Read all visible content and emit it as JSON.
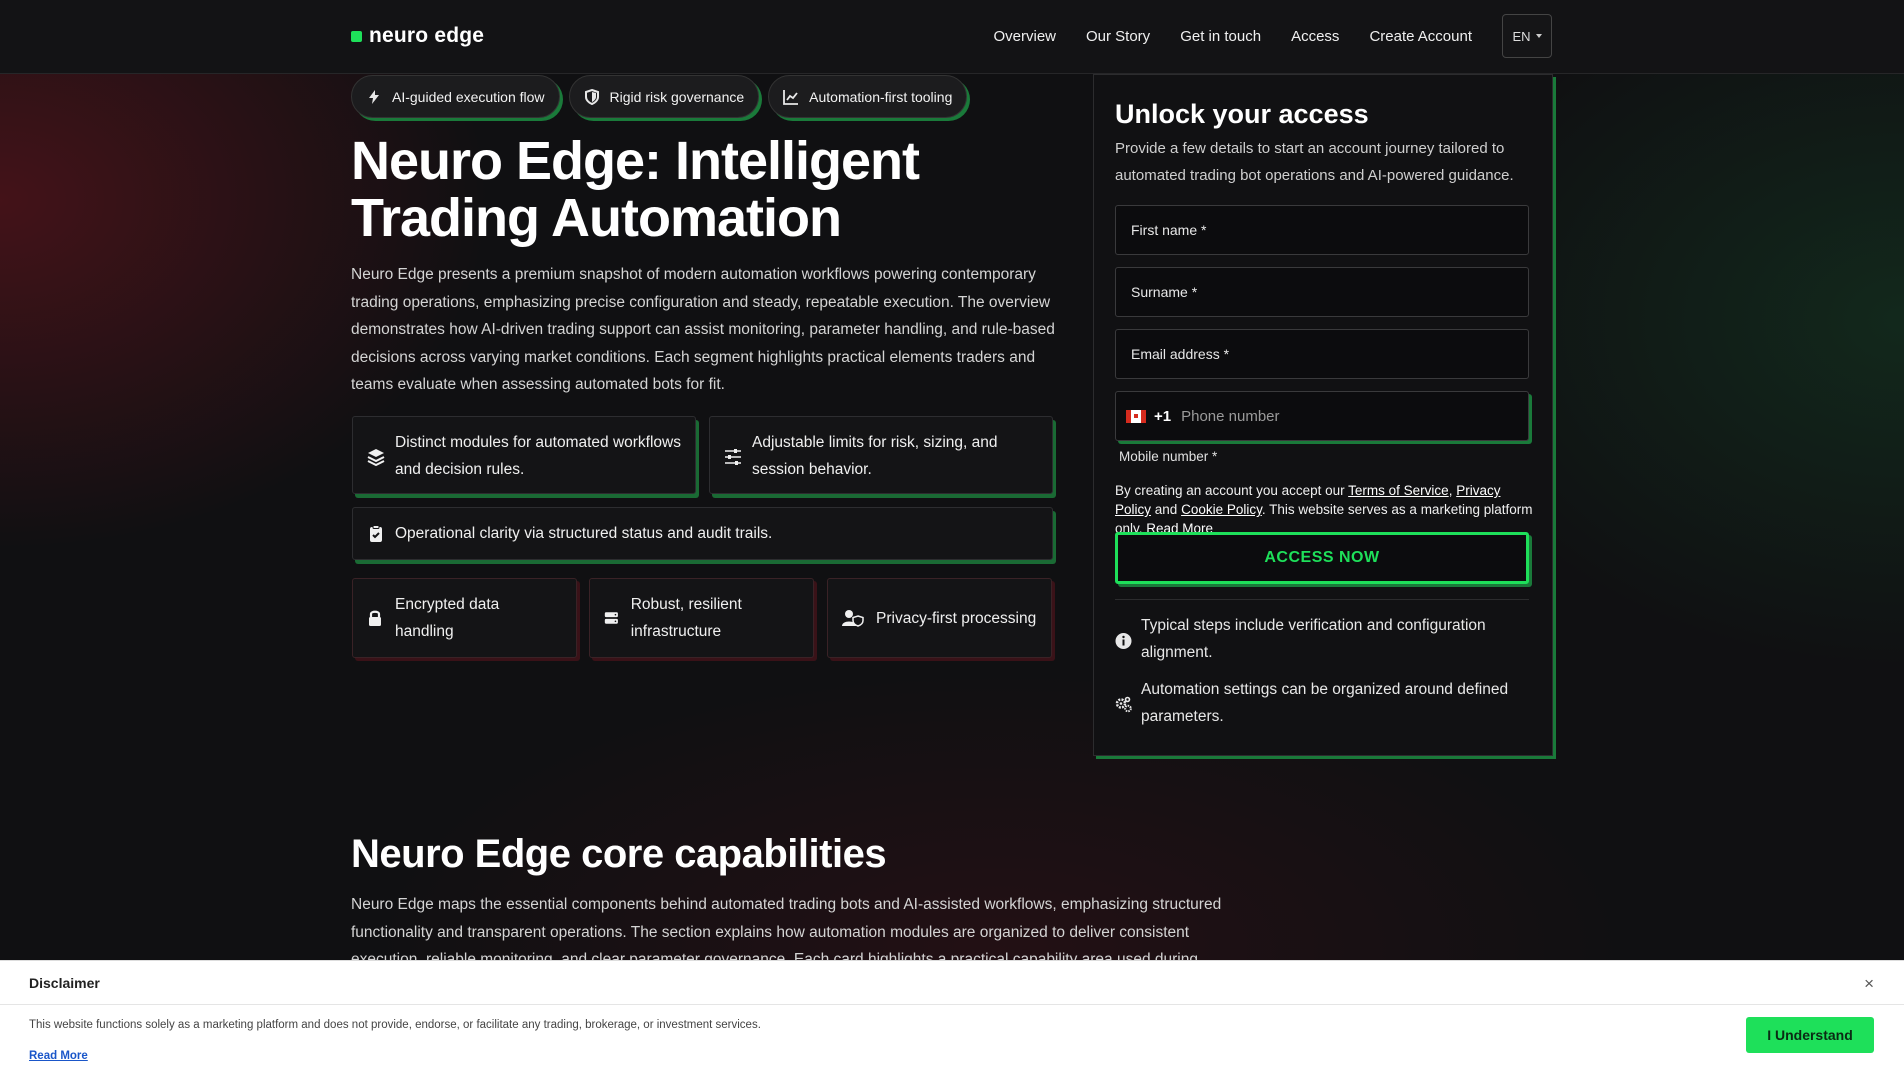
{
  "brand": {
    "name": "neuro edge",
    "accent": "#1ee05a"
  },
  "nav": {
    "items": [
      "Overview",
      "Our Story",
      "Get in touch",
      "Access",
      "Create Account"
    ],
    "lang": "EN"
  },
  "pills": [
    {
      "icon": "bolt-icon",
      "label": "AI-guided execution flow"
    },
    {
      "icon": "shield-icon",
      "label": "Rigid risk governance"
    },
    {
      "icon": "chart-line-icon",
      "label": "Automation-first tooling"
    }
  ],
  "hero": {
    "title": "Neuro Edge: Intelligent Trading Automation",
    "description": "Neuro Edge presents a premium snapshot of modern automation workflows powering contemporary trading operations, emphasizing precise configuration and steady, repeatable execution. The overview demonstrates how AI-driven trading support can assist monitoring, parameter handling, and rule-based decisions across varying market conditions. Each segment highlights practical elements traders and teams evaluate when assessing automated bots for fit."
  },
  "features": [
    {
      "icon": "layers-icon",
      "text": "Distinct modules for automated workflows and decision rules."
    },
    {
      "icon": "sliders-icon",
      "text": "Adjustable limits for risk, sizing, and session behavior."
    },
    {
      "icon": "clipboard-check-icon",
      "text": "Operational clarity via structured status and audit trails."
    }
  ],
  "badges": [
    {
      "icon": "lock-icon",
      "text": "Encrypted data handling"
    },
    {
      "icon": "server-icon",
      "text": "Robust, resilient infrastructure"
    },
    {
      "icon": "user-shield-icon",
      "text": "Privacy-first processing"
    }
  ],
  "form": {
    "title": "Unlock your access",
    "description": "Provide a few details to start an account journey tailored to automated trading bot operations and AI-powered guidance.",
    "first_name": "First name *",
    "surname": "Surname *",
    "email": "Email address *",
    "phone_code": "+1",
    "phone_placeholder": "Phone number",
    "mobile_label": "Mobile number *",
    "terms_prefix": "By creating an account you accept our",
    "terms_of_service": "Terms of Service",
    "privacy_policy": "Privacy Policy",
    "and": "and",
    "cookie_policy": "Cookie Policy",
    "terms_suffix": ". This website serves as a marketing platform only.",
    "read_more": "Read More",
    "cta": "ACCESS NOW",
    "notes": [
      {
        "icon": "info-icon",
        "text": "Typical steps include verification and configuration alignment."
      },
      {
        "icon": "gears-icon",
        "text": "Automation settings can be organized around defined parameters."
      }
    ]
  },
  "capabilities": {
    "title": "Neuro Edge core capabilities",
    "description": "Neuro Edge maps the essential components behind automated trading bots and AI-assisted workflows, emphasizing structured functionality and transparent operations. The section explains how automation modules are organized to deliver consistent execution, reliable monitoring, and clear parameter governance. Each card highlights a practical capability area used during evaluation."
  },
  "disclaimer": {
    "title": "Disclaimer",
    "text": "This website functions solely as a marketing platform and does not provide, endorse, or facilitate any trading, brokerage, or investment services.",
    "read_more": "Read More",
    "button": "I Understand",
    "close": "×"
  }
}
